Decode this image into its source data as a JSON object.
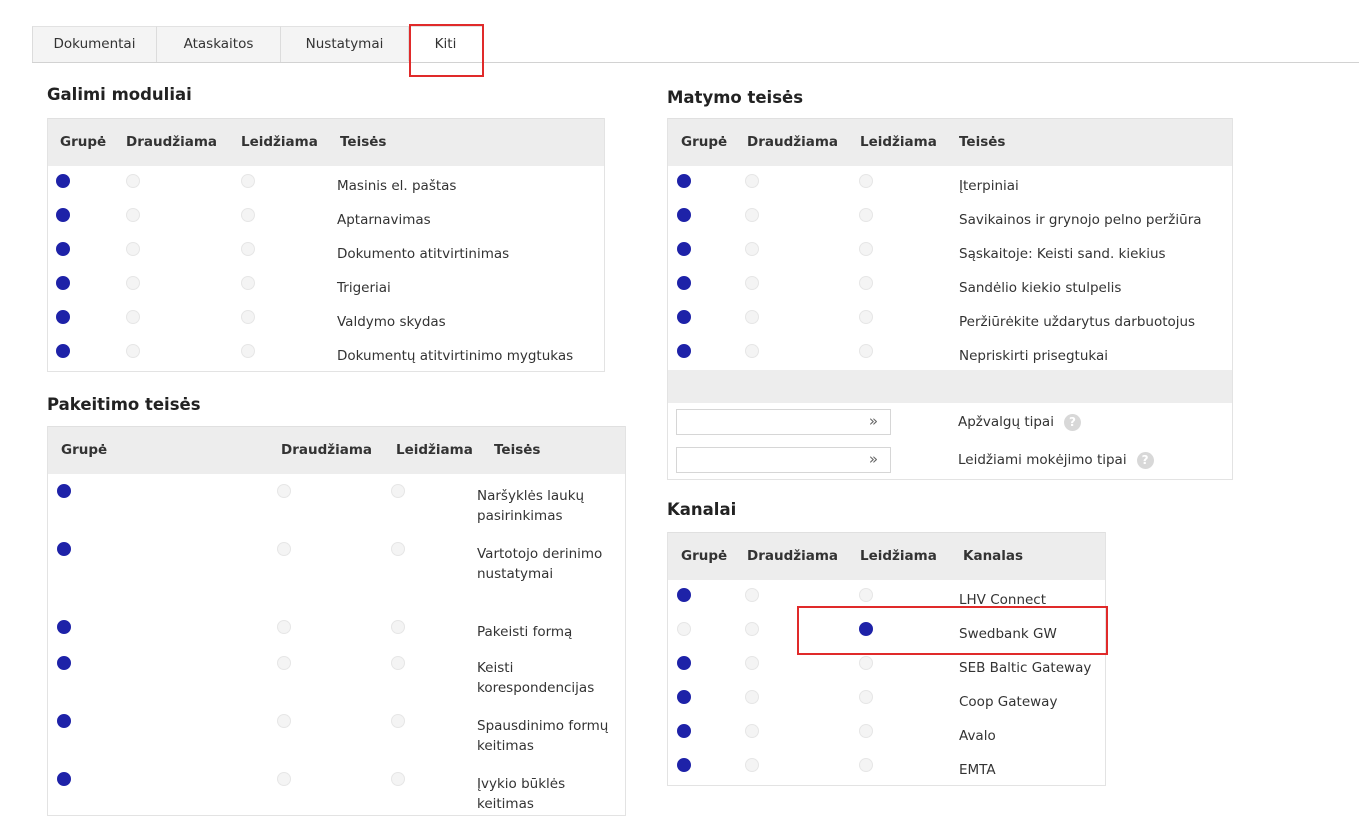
{
  "tabs": [
    "Dokumentai",
    "Ataskaitos",
    "Nustatymai",
    "Kiti"
  ],
  "galimi": {
    "title": "Galimi moduliai",
    "headers": [
      "Grupė",
      "Draudžiama",
      "Leidžiama",
      "Teisės"
    ],
    "rows": [
      {
        "label": "Masinis el. paštas",
        "sel": 0
      },
      {
        "label": "Aptarnavimas",
        "sel": 0
      },
      {
        "label": "Dokumento atitvirtinimas",
        "sel": 0
      },
      {
        "label": "Trigeriai",
        "sel": 0
      },
      {
        "label": "Valdymo skydas",
        "sel": 0
      },
      {
        "label": "Dokumentų atitvirtinimo mygtukas",
        "sel": 0
      }
    ]
  },
  "pakeitimo": {
    "title": "Pakeitimo teisės",
    "headers": [
      "Grupė",
      "Draudžiama",
      "Leidžiama",
      "Teisės"
    ],
    "rows": [
      {
        "label": "Naršyklės laukų pasirinkimas",
        "sel": 0
      },
      {
        "label": "Vartotojo derinimo nustatymai",
        "sel": 0
      },
      {
        "label": "Pakeisti formą",
        "sel": 0
      },
      {
        "label": "Keisti korespondencijas",
        "sel": 0
      },
      {
        "label": "Spausdinimo formų keitimas",
        "sel": 0
      },
      {
        "label": "Įvykio būklės keitimas",
        "sel": 0
      }
    ]
  },
  "matymo": {
    "title": "Matymo teisės",
    "headers": [
      "Grupė",
      "Draudžiama",
      "Leidžiama",
      "Teisės"
    ],
    "rows": [
      {
        "label": "Įterpiniai",
        "sel": 0
      },
      {
        "label": "Savikainos ir grynojo pelno peržiūra",
        "sel": 0
      },
      {
        "label": "Sąskaitoje: Keisti sand. kiekius",
        "sel": 0
      },
      {
        "label": "Sandėlio kiekio stulpelis",
        "sel": 0
      },
      {
        "label": "Peržiūrėkite uždarytus darbuotojus",
        "sel": 0
      },
      {
        "label": "Nepriskirti prisegtukai",
        "sel": 0
      }
    ],
    "selects": [
      {
        "label": "Apžvalgų tipai",
        "value": ""
      },
      {
        "label": "Leidžiami mokėjimo tipai",
        "value": ""
      }
    ]
  },
  "kanalai": {
    "title": "Kanalai",
    "headers": [
      "Grupė",
      "Draudžiama",
      "Leidžiama",
      "Kanalas"
    ],
    "rows": [
      {
        "label": "LHV Connect",
        "sel": 0
      },
      {
        "label": "Swedbank GW",
        "sel": 2
      },
      {
        "label": "SEB Baltic Gateway",
        "sel": 0
      },
      {
        "label": "Coop Gateway",
        "sel": 0
      },
      {
        "label": "Avalo",
        "sel": 0
      },
      {
        "label": "EMTA",
        "sel": 0
      }
    ]
  },
  "icons": {
    "expand": "»",
    "help": "?"
  },
  "colors": {
    "radio_selected": "#1e22a8",
    "highlight": "#e02a2a",
    "header_bg": "#ededed"
  }
}
